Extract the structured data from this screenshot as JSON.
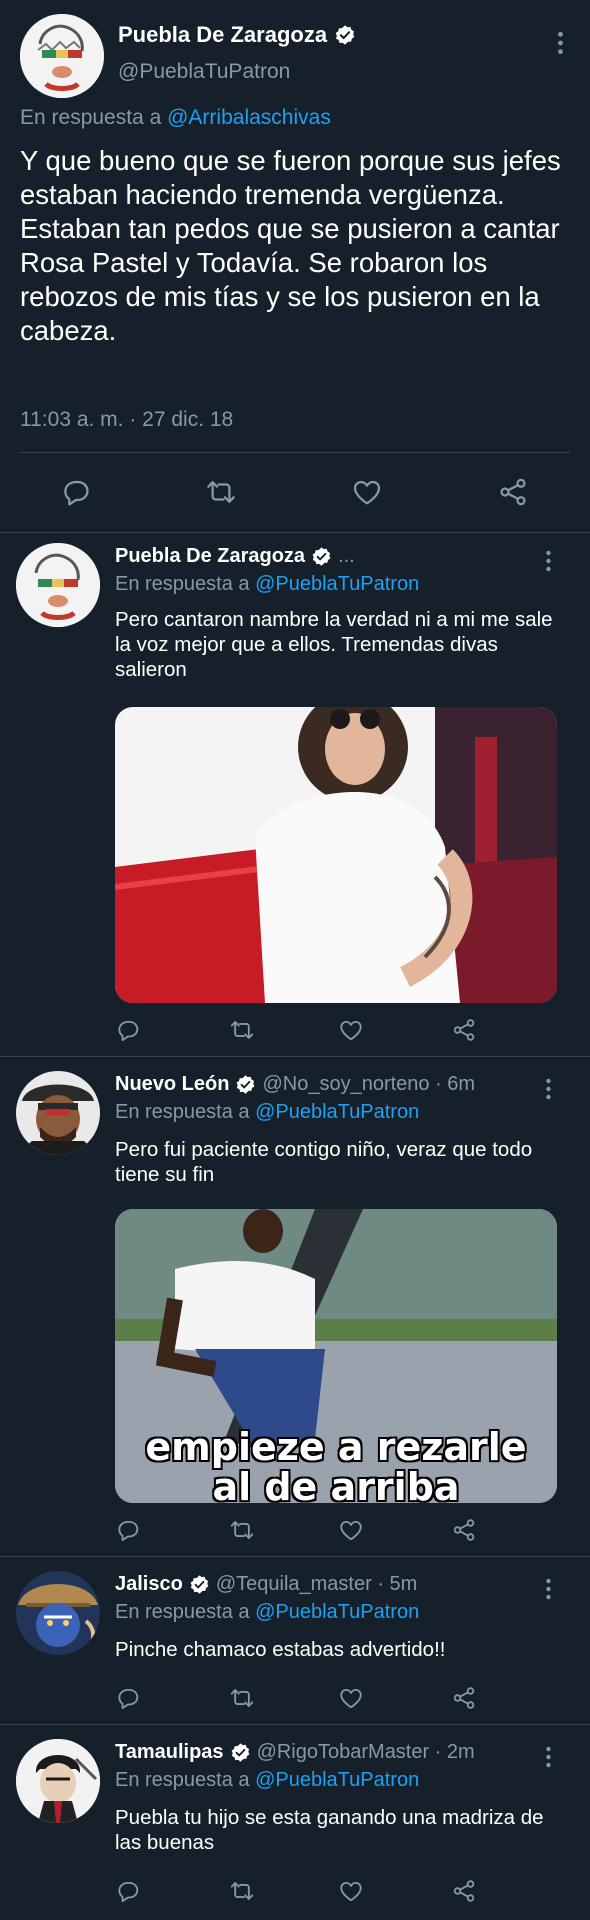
{
  "main_tweet": {
    "name": "Puebla De Zaragoza",
    "handle": "@PueblaTuPatron",
    "reply_prefix": "En respuesta a",
    "reply_to": "@Arribalaschivas",
    "text": "Y que bueno que se fueron porque sus jefes estaban haciendo tremenda vergüenza.\nEstaban tan pedos que se pusieron a cantar Rosa Pastel y Todavía. Se robaron los rebozos de mis tías y se los pusieron en la cabeza.",
    "timestamp": "11:03 a. m. · 27 dic. 18"
  },
  "replies": [
    {
      "name": "Puebla De Zaragoza",
      "meta": "...",
      "reply_prefix": "En respuesta a",
      "reply_to": "@PueblaTuPatron",
      "text": "Pero cantaron nambre la verdad ni a mi me sale la voz mejor que a ellos. Tremendas divas salieron"
    },
    {
      "name": "Nuevo León",
      "meta": "@No_soy_norteno · 6m",
      "reply_prefix": "En respuesta a",
      "reply_to": "@PueblaTuPatron",
      "text": "Pero fui paciente contigo niño, veraz que todo tiene su fin",
      "image_caption_line1": "empieze a rezarle",
      "image_caption_line2": "al de arriba"
    },
    {
      "name": "Jalisco",
      "meta": "@Tequila_master · 5m",
      "reply_prefix": "En respuesta a",
      "reply_to": "@PueblaTuPatron",
      "text": "Pinche chamaco estabas advertido!!"
    },
    {
      "name": "Tamaulipas",
      "meta": "@RigoTobarMaster · 2m",
      "reply_prefix": "En respuesta a",
      "reply_to": "@PueblaTuPatron",
      "text": "Puebla tu hijo se esta ganando una madriza de las buenas"
    }
  ],
  "colors": {
    "background": "#15202b",
    "accent": "#1da1f2",
    "muted": "#8899a6",
    "divider": "#38444d"
  },
  "icons": [
    "verified-badge-icon",
    "more-options-icon",
    "reply-icon",
    "retweet-icon",
    "like-icon",
    "share-icon"
  ]
}
